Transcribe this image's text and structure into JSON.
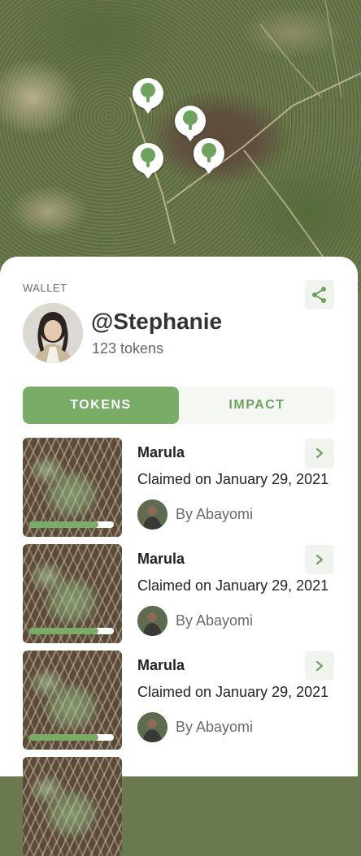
{
  "map": {
    "pin_count": 4,
    "pin_color": "#6fa35d"
  },
  "wallet": {
    "section_label": "WALLET",
    "username": "@Stephanie",
    "tokens_count": "123 tokens"
  },
  "tabs": [
    {
      "label": "TOKENS",
      "active": true
    },
    {
      "label": "IMPACT",
      "active": false
    }
  ],
  "tokens": [
    {
      "name": "Marula",
      "claimed": "Claimed on January 29, 2021",
      "owner": "By Abayomi",
      "progress": 0.82
    },
    {
      "name": "Marula",
      "claimed": "Claimed on January 29, 2021",
      "owner": "By Abayomi",
      "progress": 0.82
    },
    {
      "name": "Marula",
      "claimed": "Claimed on January 29, 2021",
      "owner": "By Abayomi",
      "progress": 0.82
    }
  ],
  "colors": {
    "accent": "#79ad67",
    "accent_text": "#6fa35d",
    "panel": "#ffffff"
  },
  "icons": {
    "share": "share-icon",
    "chevron": "chevron-right-icon",
    "pin": "tree-pin-icon"
  }
}
